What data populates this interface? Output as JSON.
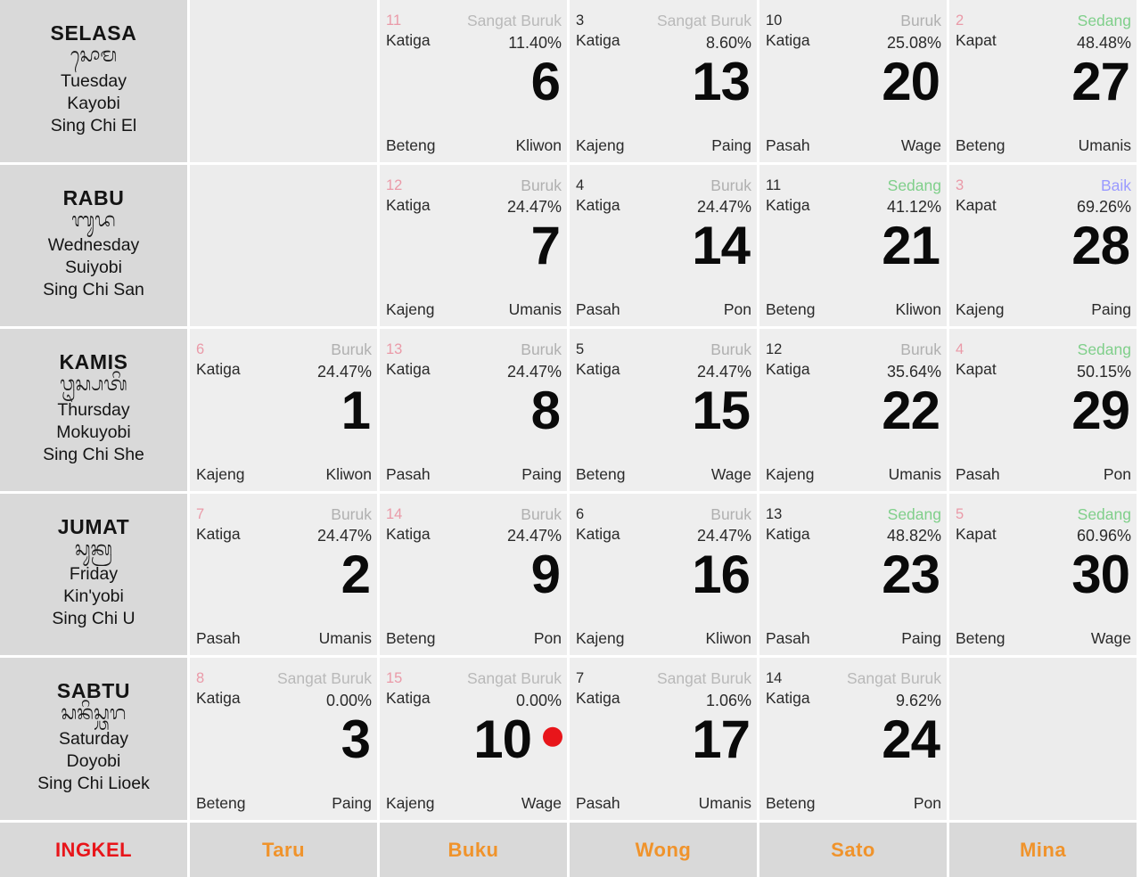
{
  "calendar": {
    "columns": 6,
    "colors": {
      "sangat_buruk": "#b9b9b9",
      "buruk": "#b0b0b0",
      "sedang": "#7fcf8a",
      "baik": "#9a9aff",
      "ingkel_label": "#e8151a",
      "ingkel_value": "#f0932b",
      "wuku_highlight": "#ea9aa8",
      "holiday_dot": "#e8151a",
      "header_bg": "#d9d9d9",
      "cell_bg": "#eeeeee"
    },
    "days": [
      {
        "id": "SELASA",
        "balinese": "ᬲᭀᬫ",
        "english": "Tuesday",
        "japanese": "Kayobi",
        "chinese": "Sing Chi El",
        "cells": [
          {
            "empty": true
          },
          {
            "empty": false,
            "wuku_num": "11",
            "wuku_num_color": "pink",
            "sasih": "Katiga",
            "quality": "Sangat Buruk",
            "quality_class": "q-sangat-buruk",
            "rate": "11.40%",
            "date": "6",
            "pancawara_bottom_left": "Beteng",
            "pancawara_bottom_right": "Kliwon",
            "dot": false
          },
          {
            "empty": false,
            "wuku_num": "3",
            "wuku_num_color": "dark",
            "sasih": "Katiga",
            "quality": "Sangat Buruk",
            "quality_class": "q-sangat-buruk",
            "rate": "8.60%",
            "date": "13",
            "pancawara_bottom_left": "Kajeng",
            "pancawara_bottom_right": "Paing",
            "dot": false
          },
          {
            "empty": false,
            "wuku_num": "10",
            "wuku_num_color": "dark",
            "sasih": "Katiga",
            "quality": "Buruk",
            "quality_class": "q-buruk",
            "rate": "25.08%",
            "date": "20",
            "pancawara_bottom_left": "Pasah",
            "pancawara_bottom_right": "Wage",
            "dot": false
          },
          {
            "empty": false,
            "wuku_num": "2",
            "wuku_num_color": "pink",
            "sasih": "Kapat",
            "quality": "Sedang",
            "quality_class": "q-sedang",
            "rate": "48.48%",
            "date": "27",
            "pancawara_bottom_left": "Beteng",
            "pancawara_bottom_right": "Umanis",
            "dot": false
          }
        ]
      },
      {
        "id": "RABU",
        "balinese": "ᬩᬸᬤ",
        "english": "Wednesday",
        "japanese": "Suiyobi",
        "chinese": "Sing Chi San",
        "cells": [
          {
            "empty": true
          },
          {
            "empty": false,
            "wuku_num": "12",
            "wuku_num_color": "pink",
            "sasih": "Katiga",
            "quality": "Buruk",
            "quality_class": "q-buruk",
            "rate": "24.47%",
            "date": "7",
            "pancawara_bottom_left": "Kajeng",
            "pancawara_bottom_right": "Umanis",
            "dot": false
          },
          {
            "empty": false,
            "wuku_num": "4",
            "wuku_num_color": "dark",
            "sasih": "Katiga",
            "quality": "Buruk",
            "quality_class": "q-buruk",
            "rate": "24.47%",
            "date": "14",
            "pancawara_bottom_left": "Pasah",
            "pancawara_bottom_right": "Pon",
            "dot": false
          },
          {
            "empty": false,
            "wuku_num": "11",
            "wuku_num_color": "dark",
            "sasih": "Katiga",
            "quality": "Sedang",
            "quality_class": "q-sedang",
            "rate": "41.12%",
            "date": "21",
            "pancawara_bottom_left": "Beteng",
            "pancawara_bottom_right": "Kliwon",
            "dot": false
          },
          {
            "empty": false,
            "wuku_num": "3",
            "wuku_num_color": "pink",
            "sasih": "Kapat",
            "quality": "Baik",
            "quality_class": "q-baik",
            "rate": "69.26%",
            "date": "28",
            "pancawara_bottom_left": "Kajeng",
            "pancawara_bottom_right": "Paing",
            "dot": false
          }
        ]
      },
      {
        "id": "KAMIS",
        "balinese": "ᬯᬺᬲ᭄ᬧᬢᬶ",
        "english": "Thursday",
        "japanese": "Mokuyobi",
        "chinese": "Sing Chi She",
        "cells": [
          {
            "empty": false,
            "wuku_num": "6",
            "wuku_num_color": "pink",
            "sasih": "Katiga",
            "quality": "Buruk",
            "quality_class": "q-buruk",
            "rate": "24.47%",
            "date": "1",
            "pancawara_bottom_left": "Kajeng",
            "pancawara_bottom_right": "Kliwon",
            "dot": false
          },
          {
            "empty": false,
            "wuku_num": "13",
            "wuku_num_color": "pink",
            "sasih": "Katiga",
            "quality": "Buruk",
            "quality_class": "q-buruk",
            "rate": "24.47%",
            "date": "8",
            "pancawara_bottom_left": "Pasah",
            "pancawara_bottom_right": "Paing",
            "dot": false
          },
          {
            "empty": false,
            "wuku_num": "5",
            "wuku_num_color": "dark",
            "sasih": "Katiga",
            "quality": "Buruk",
            "quality_class": "q-buruk",
            "rate": "24.47%",
            "date": "15",
            "pancawara_bottom_left": "Beteng",
            "pancawara_bottom_right": "Wage",
            "dot": false
          },
          {
            "empty": false,
            "wuku_num": "12",
            "wuku_num_color": "dark",
            "sasih": "Katiga",
            "quality": "Buruk",
            "quality_class": "q-buruk",
            "rate": "35.64%",
            "date": "22",
            "pancawara_bottom_left": "Kajeng",
            "pancawara_bottom_right": "Umanis",
            "dot": false
          },
          {
            "empty": false,
            "wuku_num": "4",
            "wuku_num_color": "pink",
            "sasih": "Kapat",
            "quality": "Sedang",
            "quality_class": "q-sedang",
            "rate": "50.15%",
            "date": "29",
            "pancawara_bottom_left": "Pasah",
            "pancawara_bottom_right": "Pon",
            "dot": false
          }
        ]
      },
      {
        "id": "JUMAT",
        "balinese": "ᬲᬸᬓ᭄ᬭ",
        "english": "Friday",
        "japanese": "Kin'yobi",
        "chinese": "Sing Chi U",
        "cells": [
          {
            "empty": false,
            "wuku_num": "7",
            "wuku_num_color": "pink",
            "sasih": "Katiga",
            "quality": "Buruk",
            "quality_class": "q-buruk",
            "rate": "24.47%",
            "date": "2",
            "pancawara_bottom_left": "Pasah",
            "pancawara_bottom_right": "Umanis",
            "dot": false
          },
          {
            "empty": false,
            "wuku_num": "14",
            "wuku_num_color": "pink",
            "sasih": "Katiga",
            "quality": "Buruk",
            "quality_class": "q-buruk",
            "rate": "24.47%",
            "date": "9",
            "pancawara_bottom_left": "Beteng",
            "pancawara_bottom_right": "Pon",
            "dot": false
          },
          {
            "empty": false,
            "wuku_num": "6",
            "wuku_num_color": "dark",
            "sasih": "Katiga",
            "quality": "Buruk",
            "quality_class": "q-buruk",
            "rate": "24.47%",
            "date": "16",
            "pancawara_bottom_left": "Kajeng",
            "pancawara_bottom_right": "Kliwon",
            "dot": false
          },
          {
            "empty": false,
            "wuku_num": "13",
            "wuku_num_color": "dark",
            "sasih": "Katiga",
            "quality": "Sedang",
            "quality_class": "q-sedang",
            "rate": "48.82%",
            "date": "23",
            "pancawara_bottom_left": "Pasah",
            "pancawara_bottom_right": "Paing",
            "dot": false
          },
          {
            "empty": false,
            "wuku_num": "5",
            "wuku_num_color": "pink",
            "sasih": "Kapat",
            "quality": "Sedang",
            "quality_class": "q-sedang",
            "rate": "60.96%",
            "date": "30",
            "pancawara_bottom_left": "Beteng",
            "pancawara_bottom_right": "Wage",
            "dot": false
          }
        ]
      },
      {
        "id": "SABTU",
        "balinese": "ᬲᬦᬶᬲ᭄ᬘᬭ",
        "english": "Saturday",
        "japanese": "Doyobi",
        "chinese": "Sing Chi Lioek",
        "cells": [
          {
            "empty": false,
            "wuku_num": "8",
            "wuku_num_color": "pink",
            "sasih": "Katiga",
            "quality": "Sangat Buruk",
            "quality_class": "q-sangat-buruk",
            "rate": "0.00%",
            "date": "3",
            "pancawara_bottom_left": "Beteng",
            "pancawara_bottom_right": "Paing",
            "dot": false
          },
          {
            "empty": false,
            "wuku_num": "15",
            "wuku_num_color": "pink",
            "sasih": "Katiga",
            "quality": "Sangat Buruk",
            "quality_class": "q-sangat-buruk",
            "rate": "0.00%",
            "date": "10",
            "pancawara_bottom_left": "Kajeng",
            "pancawara_bottom_right": "Wage",
            "dot": true
          },
          {
            "empty": false,
            "wuku_num": "7",
            "wuku_num_color": "dark",
            "sasih": "Katiga",
            "quality": "Sangat Buruk",
            "quality_class": "q-sangat-buruk",
            "rate": "1.06%",
            "date": "17",
            "pancawara_bottom_left": "Pasah",
            "pancawara_bottom_right": "Umanis",
            "dot": false
          },
          {
            "empty": false,
            "wuku_num": "14",
            "wuku_num_color": "dark",
            "sasih": "Katiga",
            "quality": "Sangat Buruk",
            "quality_class": "q-sangat-buruk",
            "rate": "9.62%",
            "date": "24",
            "pancawara_bottom_left": "Beteng",
            "pancawara_bottom_right": "Pon",
            "dot": false
          },
          {
            "empty": true
          }
        ]
      }
    ],
    "footer": {
      "label": "INGKEL",
      "values": [
        "Taru",
        "Buku",
        "Wong",
        "Sato",
        "Mina"
      ]
    }
  }
}
